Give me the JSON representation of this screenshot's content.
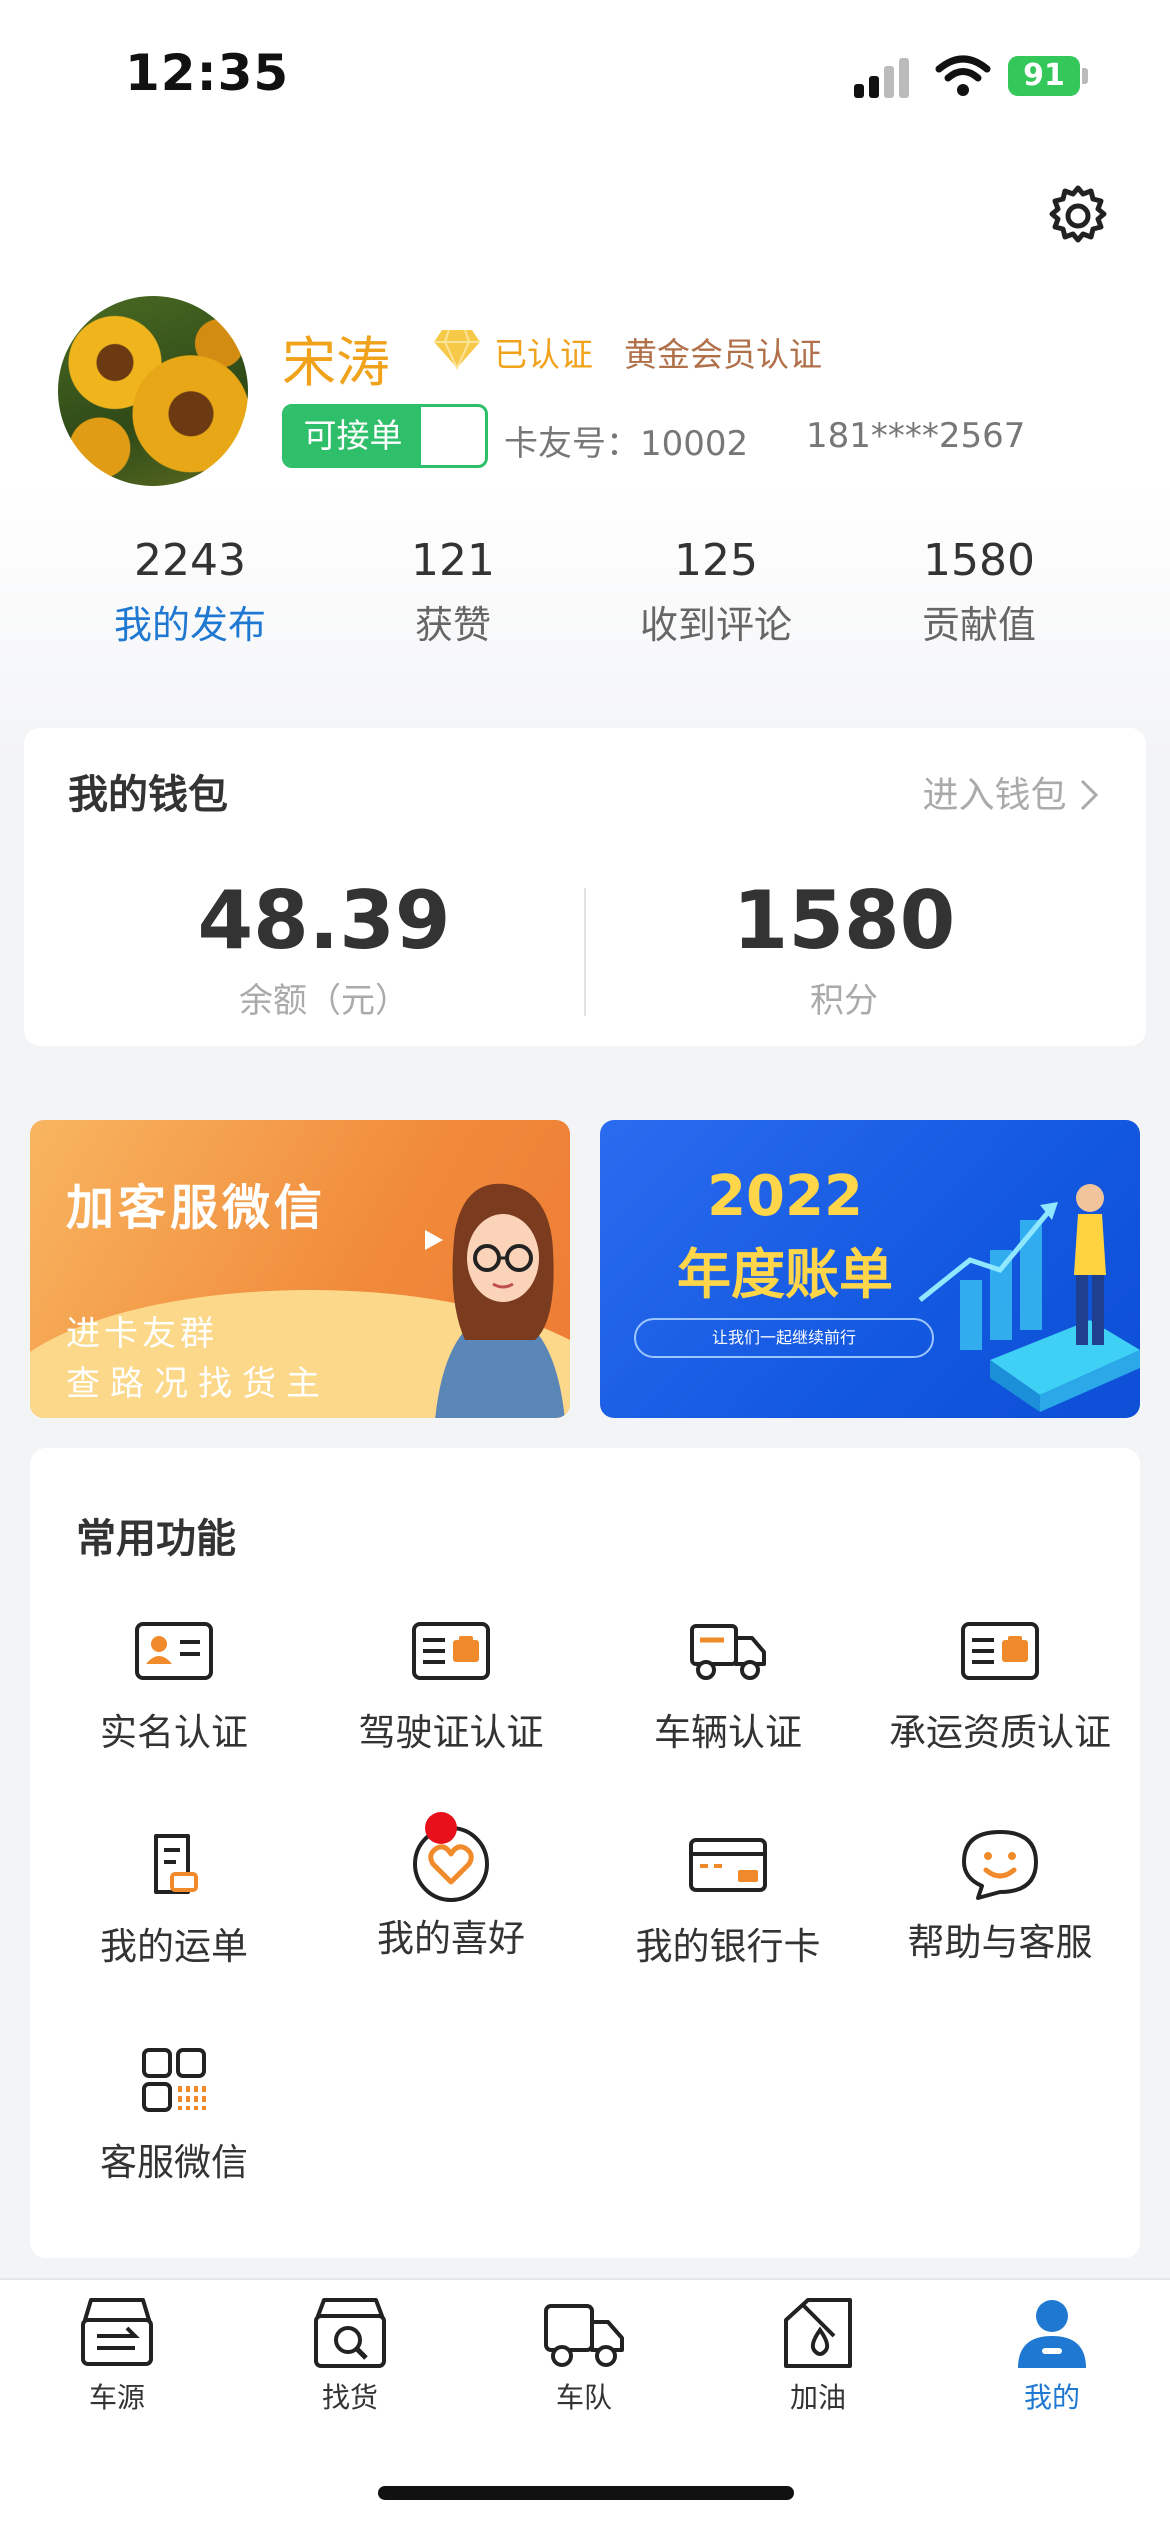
{
  "status_bar": {
    "time": "12:35",
    "battery": "91"
  },
  "profile": {
    "name": "宋涛",
    "verified": "已认证",
    "gold_cert": "黄金会员认证",
    "toggle_label": "可接单",
    "card_no": "卡友号：10002",
    "phone": "181****2567"
  },
  "stats": [
    {
      "value": "2243",
      "label": "我的发布"
    },
    {
      "value": "121",
      "label": "获赞"
    },
    {
      "value": "125",
      "label": "收到评论"
    },
    {
      "value": "1580",
      "label": "贡献值"
    }
  ],
  "wallet": {
    "title": "我的钱包",
    "enter": "进入钱包",
    "balance": "48.39",
    "balance_label": "余额（元）",
    "points": "1580",
    "points_label": "积分"
  },
  "banners": {
    "left": {
      "title": "加客服微信",
      "line1": "进卡友群",
      "line2": "查路况找货主"
    },
    "right": {
      "year": "2022",
      "title": "年度账单",
      "pill": "让我们一起继续前行"
    }
  },
  "functions": {
    "title": "常用功能",
    "items": [
      {
        "label": "实名认证",
        "icon": "id-card-icon"
      },
      {
        "label": "驾驶证认证",
        "icon": "license-icon"
      },
      {
        "label": "车辆认证",
        "icon": "truck-icon"
      },
      {
        "label": "承运资质认证",
        "icon": "qualification-icon"
      },
      {
        "label": "我的运单",
        "icon": "waybill-icon"
      },
      {
        "label": "我的喜好",
        "icon": "heart-icon"
      },
      {
        "label": "我的银行卡",
        "icon": "bank-card-icon"
      },
      {
        "label": "帮助与客服",
        "icon": "chat-smile-icon"
      },
      {
        "label": "客服微信",
        "icon": "qr-code-icon"
      }
    ]
  },
  "tabbar": {
    "items": [
      {
        "label": "车源",
        "icon": "truck-source-icon"
      },
      {
        "label": "找货",
        "icon": "find-cargo-icon"
      },
      {
        "label": "车队",
        "icon": "fleet-icon"
      },
      {
        "label": "加油",
        "icon": "fuel-icon"
      },
      {
        "label": "我的",
        "icon": "user-icon",
        "active": true
      }
    ]
  },
  "colors": {
    "accent": "#1f78d1",
    "gold": "#f0a21a",
    "green": "#2fbf6a",
    "badge_red": "#e8111b"
  }
}
